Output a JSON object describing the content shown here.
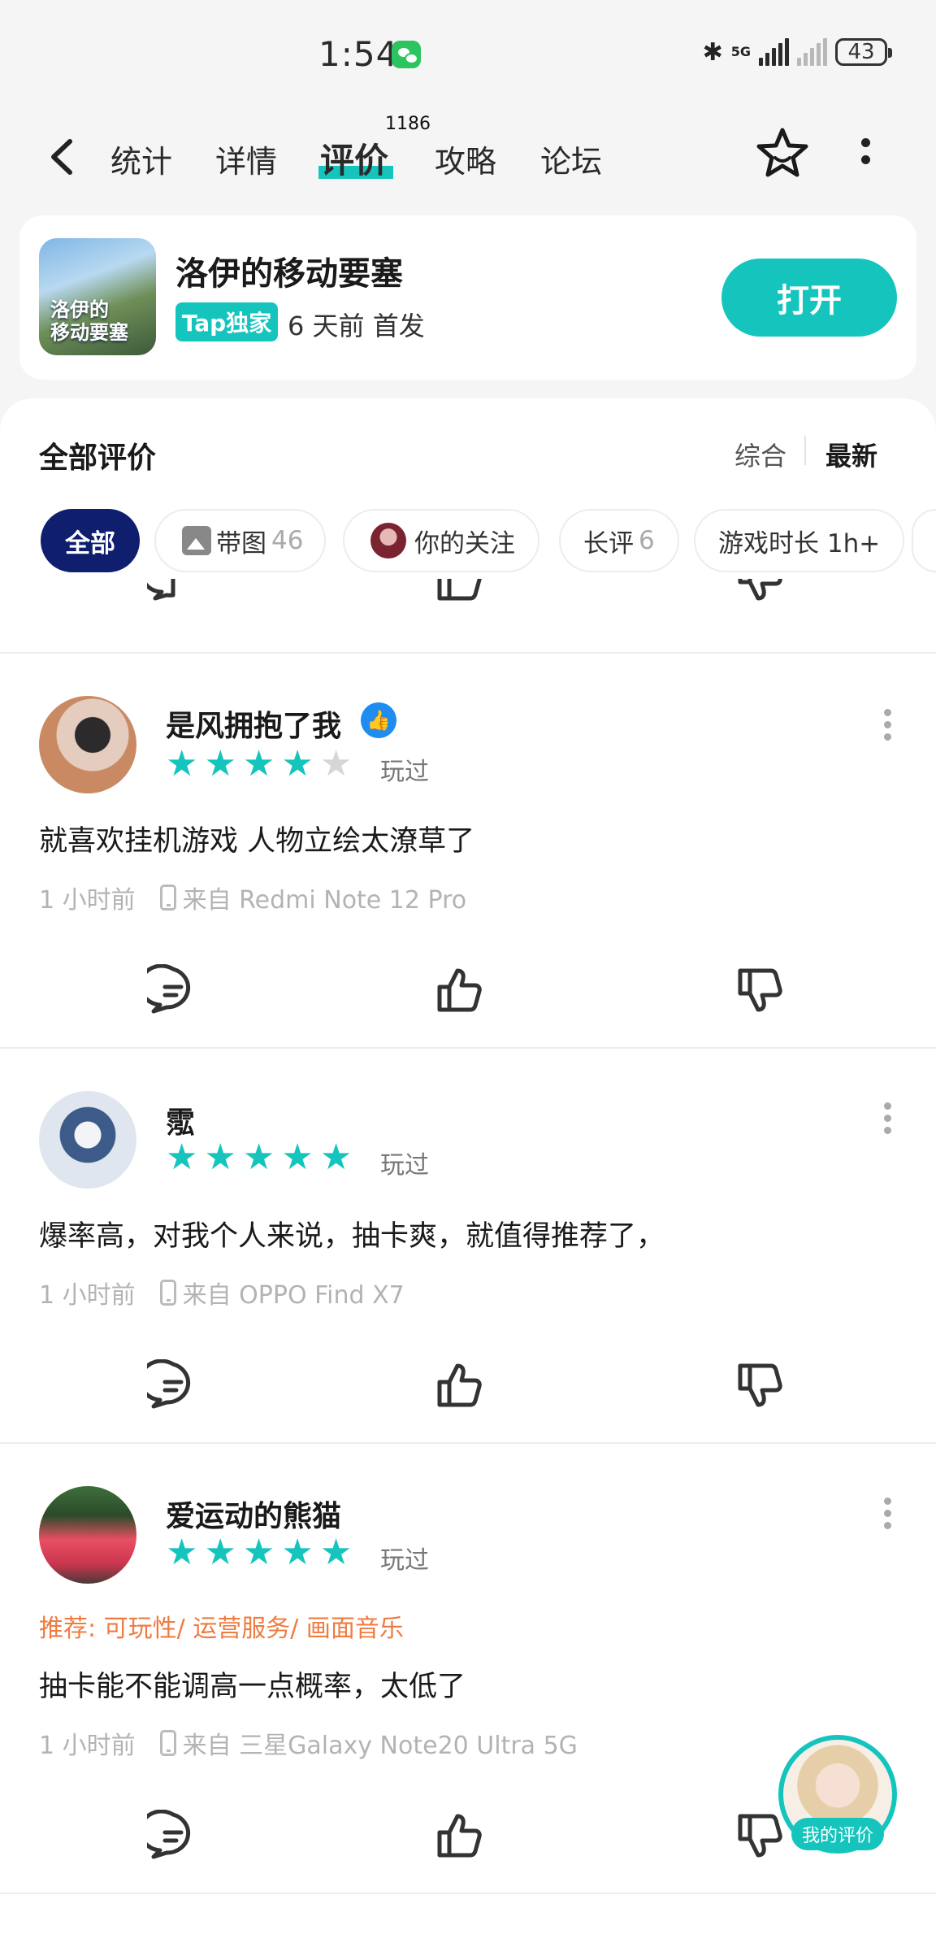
{
  "status_bar": {
    "time": "1:54",
    "network": "5G",
    "battery": "43"
  },
  "nav": {
    "tabs": [
      {
        "label": "统计"
      },
      {
        "label": "详情"
      },
      {
        "label": "评价",
        "badge": "1186",
        "active": true
      },
      {
        "label": "攻略"
      },
      {
        "label": "论坛"
      }
    ]
  },
  "game": {
    "icon_text": "洛伊的\n移动要塞",
    "title": "洛伊的移动要塞",
    "badge": "Tap独家",
    "release": "6 天前 首发",
    "open_label": "打开"
  },
  "reviews_header": {
    "title": "全部评价",
    "sort_comprehensive": "综合",
    "sort_latest": "最新"
  },
  "filters": [
    {
      "label": "全部",
      "active": true
    },
    {
      "label": "带图",
      "count": "46"
    },
    {
      "label": "你的关注"
    },
    {
      "label": "长评",
      "count": "6"
    },
    {
      "label": "游戏时长 1h+"
    }
  ],
  "reviews": [
    {
      "username": "是风拥抱了我",
      "rating": 4,
      "status": "玩过",
      "text": "就喜欢挂机游戏 人物立绘太潦草了",
      "time": "1 小时前",
      "device": "来自 Redmi Note 12 Pro"
    },
    {
      "username": "霐",
      "rating": 5,
      "status": "玩过",
      "text": "爆率高，对我个人来说，抽卡爽，就值得推荐了，",
      "time": "1 小时前",
      "device": "来自 OPPO Find X7"
    },
    {
      "username": "爱运动的熊猫",
      "rating": 5,
      "status": "玩过",
      "recommend": "推荐: 可玩性/ 运营服务/ 画面音乐",
      "text": "抽卡能不能调高一点概率，太低了",
      "time": "1 小时前",
      "device": "来自 三星Galaxy Note20 Ultra 5G"
    }
  ],
  "fab": {
    "label": "我的评价"
  },
  "colors": {
    "accent": "#15c5bd",
    "dark_chip": "#0f1f6e",
    "recommend": "#f07b3f"
  }
}
